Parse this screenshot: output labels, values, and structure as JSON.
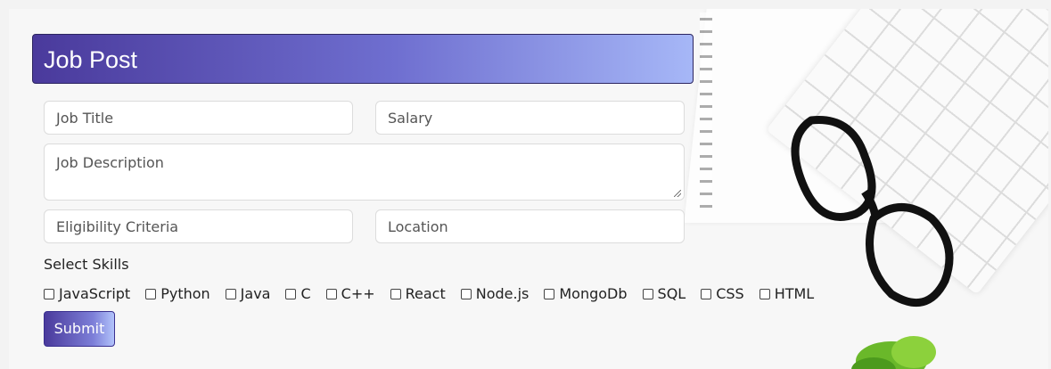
{
  "header": {
    "title": "Job Post"
  },
  "form": {
    "job_title": {
      "placeholder": "Job Title",
      "value": ""
    },
    "salary": {
      "placeholder": "Salary",
      "value": ""
    },
    "job_description": {
      "placeholder": "Job Description",
      "value": ""
    },
    "eligibility": {
      "placeholder": "Eligibility Criteria",
      "value": ""
    },
    "location": {
      "placeholder": "Location",
      "value": ""
    },
    "skills_label": "Select Skills",
    "skills": [
      {
        "label": "JavaScript",
        "checked": false
      },
      {
        "label": "Python",
        "checked": false
      },
      {
        "label": "Java",
        "checked": false
      },
      {
        "label": "C",
        "checked": false
      },
      {
        "label": "C++",
        "checked": false
      },
      {
        "label": "React",
        "checked": false
      },
      {
        "label": "Node.js",
        "checked": false
      },
      {
        "label": "MongoDb",
        "checked": false
      },
      {
        "label": "SQL",
        "checked": false
      },
      {
        "label": "CSS",
        "checked": false
      },
      {
        "label": "HTML",
        "checked": false
      }
    ],
    "submit_label": "Submit"
  },
  "colors": {
    "header_start": "#4a3a9c",
    "header_end": "#a6b7f7"
  },
  "decor": {
    "background_image": "desk-scene-image"
  }
}
